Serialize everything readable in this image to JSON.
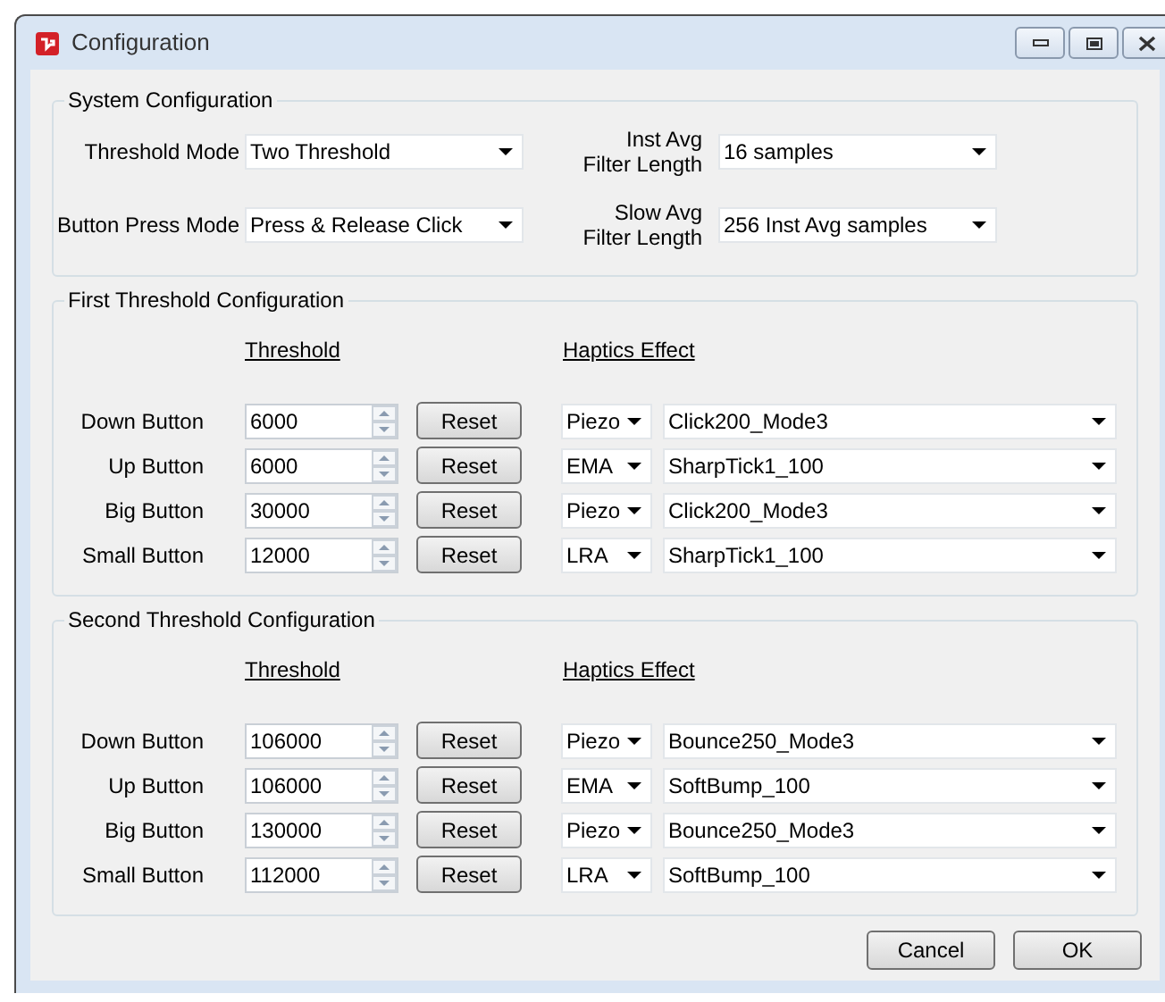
{
  "window": {
    "title": "Configuration"
  },
  "system_configuration": {
    "title": "System Configuration",
    "fields": [
      {
        "label": "Threshold Mode",
        "value": "Two Threshold"
      },
      {
        "label": "Inst Avg\nFilter Length",
        "value": "16 samples"
      },
      {
        "label": "Button Press Mode",
        "value": "Press & Release Click"
      },
      {
        "label": "Slow Avg\nFilter Length",
        "value": "256 Inst Avg samples"
      }
    ]
  },
  "threshold_sections": [
    {
      "title": "First Threshold Configuration",
      "threshold_header": "Threshold",
      "haptics_header": "Haptics Effect",
      "rows": [
        {
          "label": "Down Button",
          "threshold": "6000",
          "reset": "Reset",
          "actuator": "Piezo",
          "effect": "Click200_Mode3"
        },
        {
          "label": "Up Button",
          "threshold": "6000",
          "reset": "Reset",
          "actuator": "EMA",
          "effect": "SharpTick1_100"
        },
        {
          "label": "Big Button",
          "threshold": "30000",
          "reset": "Reset",
          "actuator": "Piezo",
          "effect": "Click200_Mode3"
        },
        {
          "label": "Small Button",
          "threshold": "12000",
          "reset": "Reset",
          "actuator": "LRA",
          "effect": "SharpTick1_100"
        }
      ]
    },
    {
      "title": "Second Threshold Configuration",
      "threshold_header": "Threshold",
      "haptics_header": "Haptics Effect",
      "rows": [
        {
          "label": "Down Button",
          "threshold": "106000",
          "reset": "Reset",
          "actuator": "Piezo",
          "effect": "Bounce250_Mode3"
        },
        {
          "label": "Up Button",
          "threshold": "106000",
          "reset": "Reset",
          "actuator": "EMA",
          "effect": "SoftBump_100"
        },
        {
          "label": "Big Button",
          "threshold": "130000",
          "reset": "Reset",
          "actuator": "Piezo",
          "effect": "Bounce250_Mode3"
        },
        {
          "label": "Small Button",
          "threshold": "112000",
          "reset": "Reset",
          "actuator": "LRA",
          "effect": "SoftBump_100"
        }
      ]
    }
  ],
  "buttons": [
    "Cancel",
    "OK"
  ]
}
